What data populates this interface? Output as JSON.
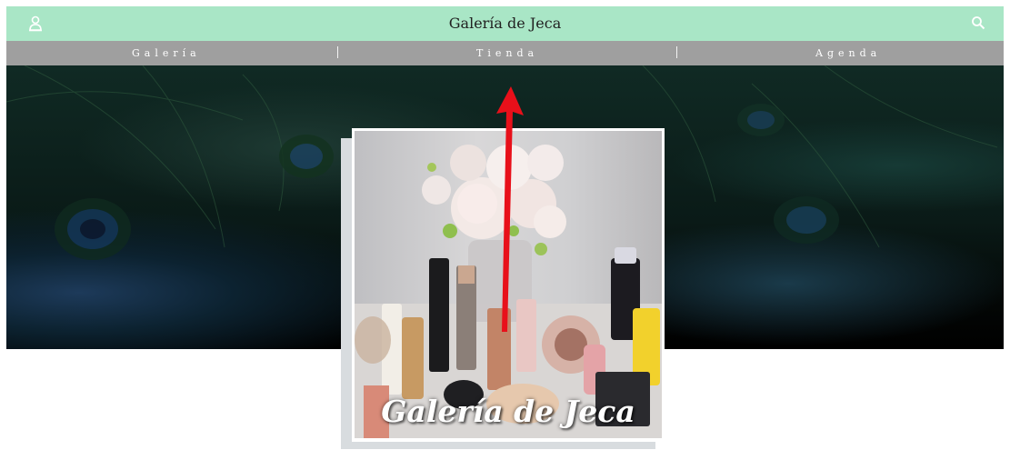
{
  "header": {
    "title": "Galería de Jeca",
    "user_icon": "user-icon",
    "search_icon": "search-icon",
    "bg_color": "#a9e6c6"
  },
  "nav": {
    "items": [
      {
        "label": "Galería"
      },
      {
        "label": "Tienda"
      },
      {
        "label": "Agenda"
      }
    ],
    "bg_color": "#9f9f9f"
  },
  "hero": {
    "image": "peacock-feathers-background"
  },
  "featured": {
    "image": "makeup-products-and-flowers-photo",
    "logo_text": "Galería de Jeca"
  },
  "annotation": {
    "icon": "red-arrow-up",
    "color": "#e8101a"
  }
}
